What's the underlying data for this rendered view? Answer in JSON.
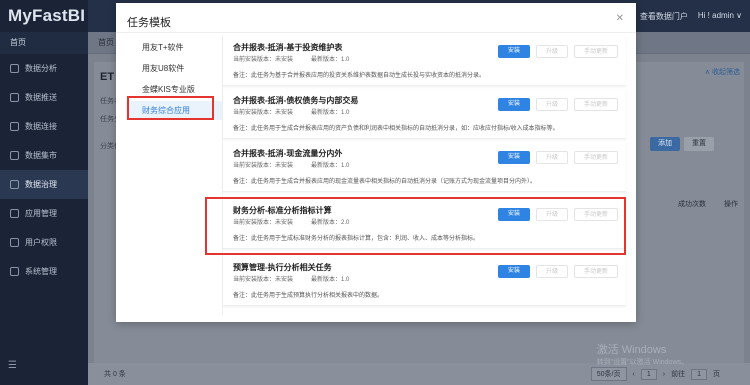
{
  "app": {
    "brand": "MyFastBI",
    "nav_home": "首页",
    "nav": [
      "数据分析",
      "数据推送",
      "数据连接",
      "数据集市",
      "数据治理",
      "应用管理",
      "用户权限",
      "系统管理"
    ],
    "nav_active_index": 4,
    "nav_bottom_icon": "menu-toggle-icon",
    "top_right": {
      "portal": "查看数据门户",
      "user": "Hi ! admin ∨"
    },
    "tab_home": "首页",
    "bg_title": "ET",
    "bg_link": "∧ 收起筛选",
    "bg_small": [
      "任务名",
      "任务分",
      "分类任"
    ],
    "bg_buttons": [
      "添加",
      "重置"
    ],
    "bg_cols": [
      "成功次数",
      "操作"
    ],
    "total": "共 0 条",
    "pager": {
      "size": "50条/页",
      "prev": "‹",
      "page": "1",
      "next": "›",
      "goto": "前往",
      "goto_page": "1",
      "unit": "页"
    },
    "watermark": {
      "line1": "激活 Windows",
      "line2": "转到\"设置\"以激活 Windows。"
    }
  },
  "modal": {
    "title": "任务模板",
    "close_icon": "close-icon",
    "categories": [
      "用友T+软件",
      "用友U8软件",
      "金蝶KIS专业版",
      "财务综合应用"
    ],
    "active_category": 3,
    "buttons": {
      "install": "安装",
      "upgrade": "升级",
      "manual": "手动更新"
    },
    "tasks": [
      {
        "name": "合并报表-抵消-基于投资维护表",
        "current": "当前安装版本：未安装",
        "latest": "最新版本：1.0",
        "desc": "备注：此任务为基于合并报表应用的投资关系维护表数据自动生成长投与实收资本的抵消分录。"
      },
      {
        "name": "合并报表-抵消-债权债务与内部交易",
        "current": "当前安装版本：未安装",
        "latest": "最新版本：1.0",
        "desc": "备注：此任务用于生成合并报表应用的资产负债和利润表中相关指标的自动抵消分录，如：应收应付指标/收入成本指标等。"
      },
      {
        "name": "合并报表-抵消-现金流量分内外",
        "current": "当前安装版本：未安装",
        "latest": "最新版本：1.0",
        "desc": "备注：此任务用于生成合并报表应用的现金流量表中相关指标的自动抵消分录（记账方式为现金流量项目分内外）。"
      },
      {
        "name": "财务分析-标准分析指标计算",
        "current": "当前安装版本：未安装",
        "latest": "最新版本：2.0",
        "desc": "备注：此任务用于生成标准财务分析的报表指标计算，包含：利润、收入、成本等分析指标。"
      },
      {
        "name": "预算管理-执行分析相关任务",
        "current": "当前安装版本：未安装",
        "latest": "最新版本：1.0",
        "desc": "备注：此任务用于生成预算执行分析相关报表中的数据。"
      }
    ]
  }
}
